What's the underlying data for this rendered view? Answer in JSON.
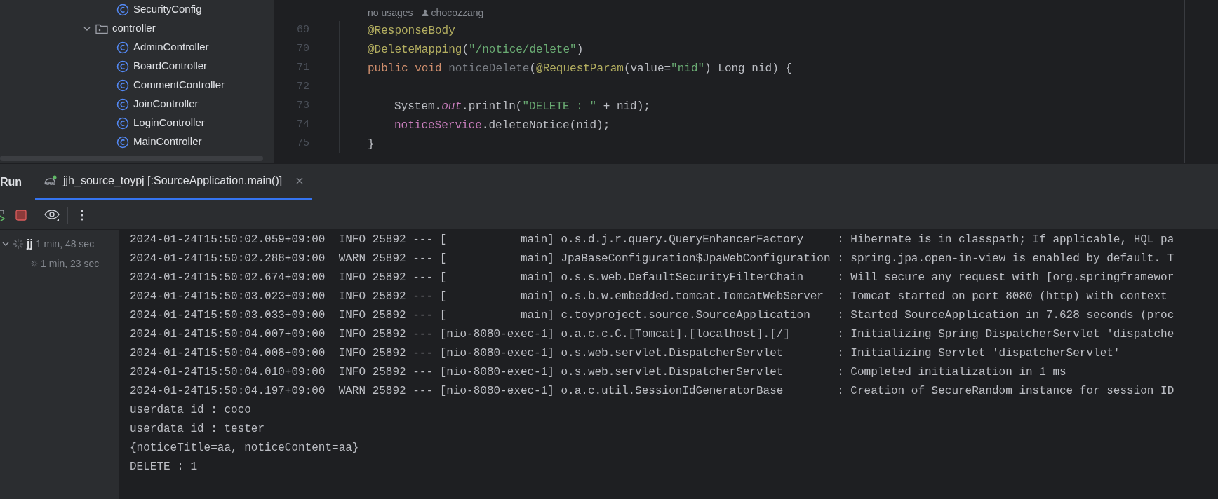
{
  "project_tree": {
    "items": [
      {
        "kind": "class",
        "label": "SecurityConfig"
      },
      {
        "kind": "folder",
        "label": "controller",
        "expanded": true,
        "children": [
          {
            "kind": "class",
            "label": "AdminController"
          },
          {
            "kind": "class",
            "label": "BoardController"
          },
          {
            "kind": "class",
            "label": "CommentController"
          },
          {
            "kind": "class",
            "label": "JoinController"
          },
          {
            "kind": "class",
            "label": "LoginController"
          },
          {
            "kind": "class",
            "label": "MainController"
          }
        ]
      }
    ]
  },
  "editor": {
    "hint": {
      "usages": "no usages",
      "author": "chocozzang"
    },
    "lines": [
      {
        "number": "69",
        "tokens": [
          {
            "kind": "annotation",
            "text": "@ResponseBody"
          }
        ]
      },
      {
        "number": "70",
        "tokens": [
          {
            "kind": "annotation",
            "text": "@DeleteMapping"
          },
          {
            "kind": "plain",
            "text": "("
          },
          {
            "kind": "string",
            "text": "\"/notice/delete\""
          },
          {
            "kind": "plain",
            "text": ")"
          }
        ]
      },
      {
        "number": "71",
        "tokens": [
          {
            "kind": "keyword",
            "text": "public void "
          },
          {
            "kind": "unused",
            "text": "noticeDelete"
          },
          {
            "kind": "plain",
            "text": "("
          },
          {
            "kind": "annotation",
            "text": "@RequestParam"
          },
          {
            "kind": "plain",
            "text": "(value="
          },
          {
            "kind": "string",
            "text": "\"nid\""
          },
          {
            "kind": "plain",
            "text": ") Long nid) {"
          }
        ]
      },
      {
        "number": "72"
      },
      {
        "number": "73",
        "indent": true,
        "tokens": [
          {
            "kind": "plain",
            "text": "System."
          },
          {
            "kind": "static",
            "text": "out"
          },
          {
            "kind": "plain",
            "text": ".println("
          },
          {
            "kind": "string",
            "text": "\"DELETE : \""
          },
          {
            "kind": "plain",
            "text": " + nid);"
          }
        ]
      },
      {
        "number": "74",
        "indent": true,
        "tokens": [
          {
            "kind": "field",
            "text": "noticeService"
          },
          {
            "kind": "plain",
            "text": ".deleteNotice(nid);"
          }
        ]
      },
      {
        "number": "75",
        "tokens": [
          {
            "kind": "plain",
            "text": "}"
          }
        ]
      }
    ]
  },
  "run_panel": {
    "title": "Run",
    "tabs": [
      {
        "label": "jjh_source_toypj [:SourceApplication.main()]",
        "selected": true
      }
    ],
    "processes": [
      {
        "label": "jj",
        "time": "1 min, 48 sec",
        "expanded": true
      },
      {
        "time": "1 min, 23 sec"
      }
    ],
    "console": [
      "2024-01-24T15:50:02.059+09:00  INFO 25892 --- [           main] o.s.d.j.r.query.QueryEnhancerFactory     : Hibernate is in classpath; If applicable, HQL pa",
      "2024-01-24T15:50:02.288+09:00  WARN 25892 --- [           main] JpaBaseConfiguration$JpaWebConfiguration : spring.jpa.open-in-view is enabled by default. T",
      "2024-01-24T15:50:02.674+09:00  INFO 25892 --- [           main] o.s.s.web.DefaultSecurityFilterChain     : Will secure any request with [org.springframewor",
      "2024-01-24T15:50:03.023+09:00  INFO 25892 --- [           main] o.s.b.w.embedded.tomcat.TomcatWebServer  : Tomcat started on port 8080 (http) with context",
      "2024-01-24T15:50:03.033+09:00  INFO 25892 --- [           main] c.toyproject.source.SourceApplication    : Started SourceApplication in 7.628 seconds (proc",
      "2024-01-24T15:50:04.007+09:00  INFO 25892 --- [nio-8080-exec-1] o.a.c.c.C.[Tomcat].[localhost].[/]       : Initializing Spring DispatcherServlet 'dispatche",
      "2024-01-24T15:50:04.008+09:00  INFO 25892 --- [nio-8080-exec-1] o.s.web.servlet.DispatcherServlet        : Initializing Servlet 'dispatcherServlet'",
      "2024-01-24T15:50:04.010+09:00  INFO 25892 --- [nio-8080-exec-1] o.s.web.servlet.DispatcherServlet        : Completed initialization in 1 ms",
      "2024-01-24T15:50:04.197+09:00  WARN 25892 --- [nio-8080-exec-1] o.a.c.util.SessionIdGeneratorBase        : Creation of SecureRandom instance for session ID",
      "userdata id : coco",
      "userdata id : tester",
      "{noticeTitle=aa, noticeContent=aa}",
      "DELETE : 1"
    ]
  }
}
